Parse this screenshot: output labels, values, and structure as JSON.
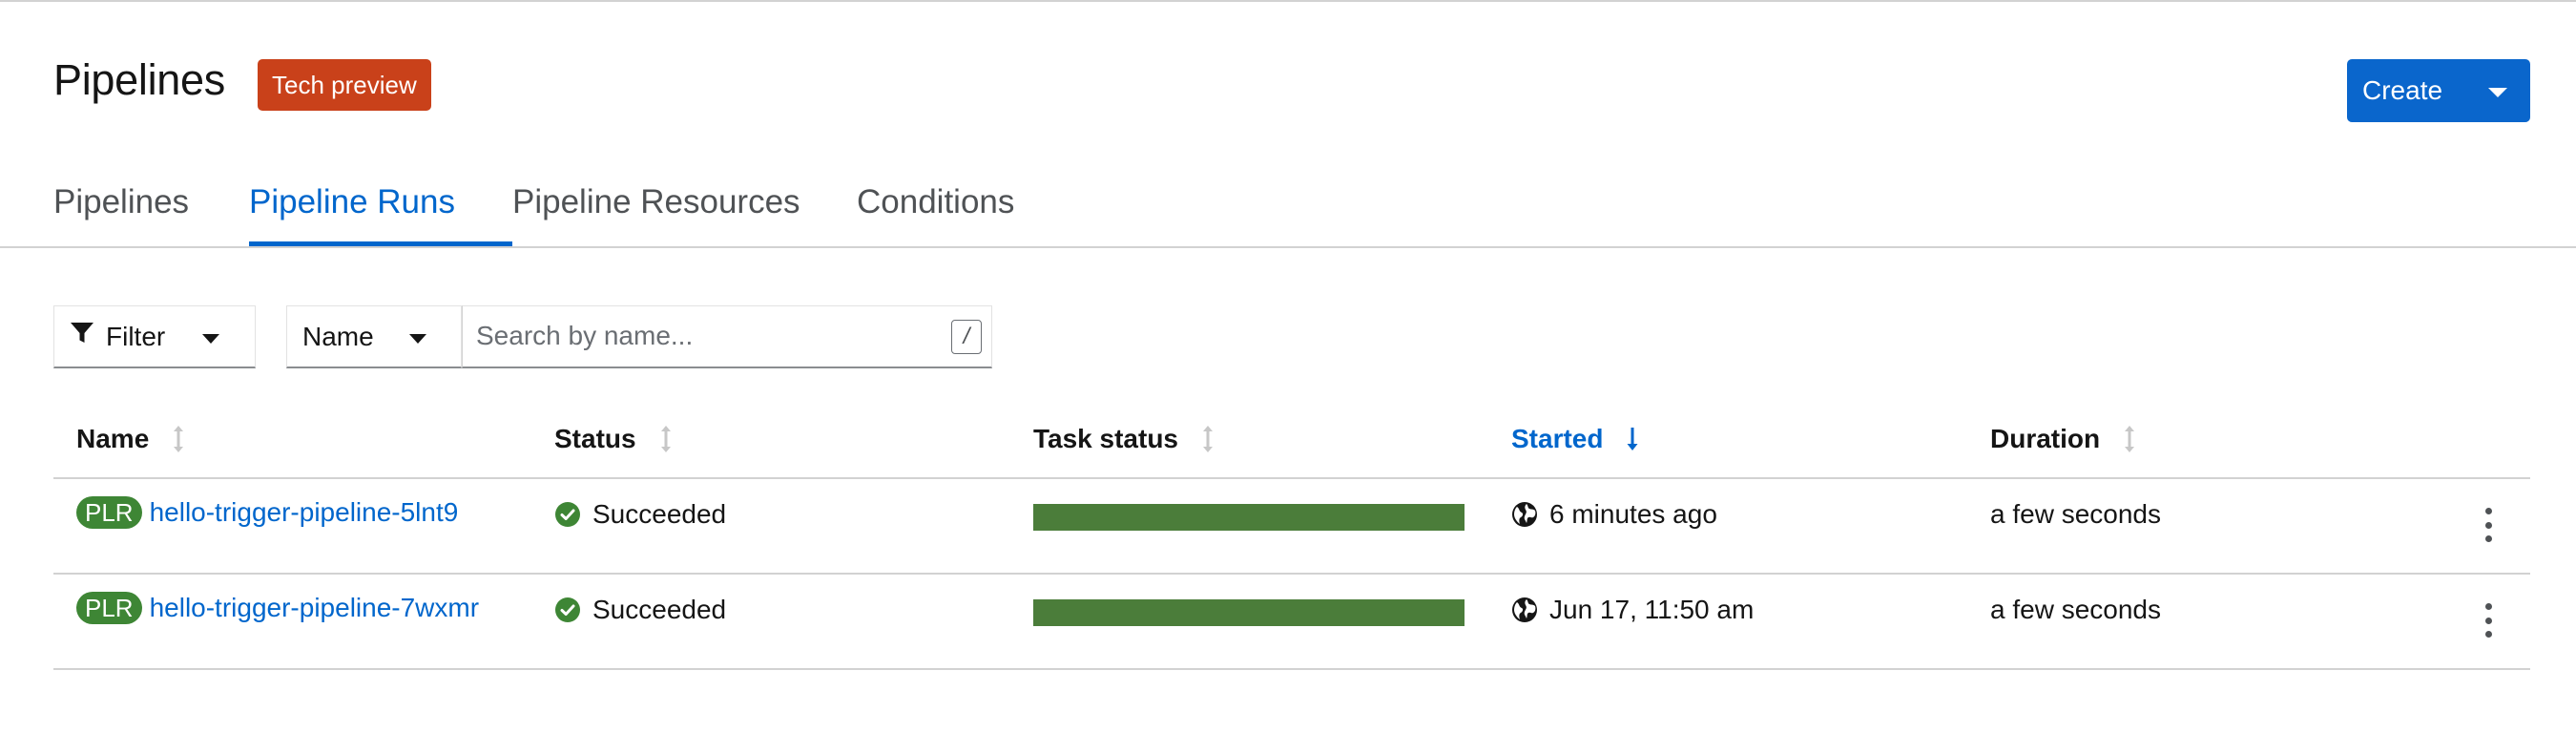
{
  "header": {
    "title": "Pipelines",
    "badge": "Tech preview",
    "create_label": "Create"
  },
  "tabs": [
    {
      "label": "Pipelines",
      "active": false
    },
    {
      "label": "Pipeline Runs",
      "active": true
    },
    {
      "label": "Pipeline Resources",
      "active": false
    },
    {
      "label": "Conditions",
      "active": false
    }
  ],
  "toolbar": {
    "filter_label": "Filter",
    "filter_icon": "filter-icon",
    "name_select": "Name",
    "search_placeholder": "Search by name...",
    "search_value": "",
    "shortcut_key": "/"
  },
  "table": {
    "columns": [
      {
        "label": "Name",
        "sort": "none"
      },
      {
        "label": "Status",
        "sort": "none"
      },
      {
        "label": "Task status",
        "sort": "none"
      },
      {
        "label": "Started",
        "sort": "desc"
      },
      {
        "label": "Duration",
        "sort": "none"
      }
    ],
    "rows": [
      {
        "badge": "PLR",
        "name": "hello-trigger-pipeline-5lnt9",
        "status": "Succeeded",
        "task_status_fraction": 1.0,
        "started": "6 minutes ago",
        "duration": "a few seconds"
      },
      {
        "badge": "PLR",
        "name": "hello-trigger-pipeline-7wxmr",
        "status": "Succeeded",
        "task_status_fraction": 1.0,
        "started": "Jun 17, 11:50 am",
        "duration": "a few seconds"
      }
    ]
  },
  "colors": {
    "accent": "#0066cc",
    "badge_orange": "#c9411a",
    "success_green": "#3e8635",
    "task_bar_green": "#4b7d3a"
  }
}
